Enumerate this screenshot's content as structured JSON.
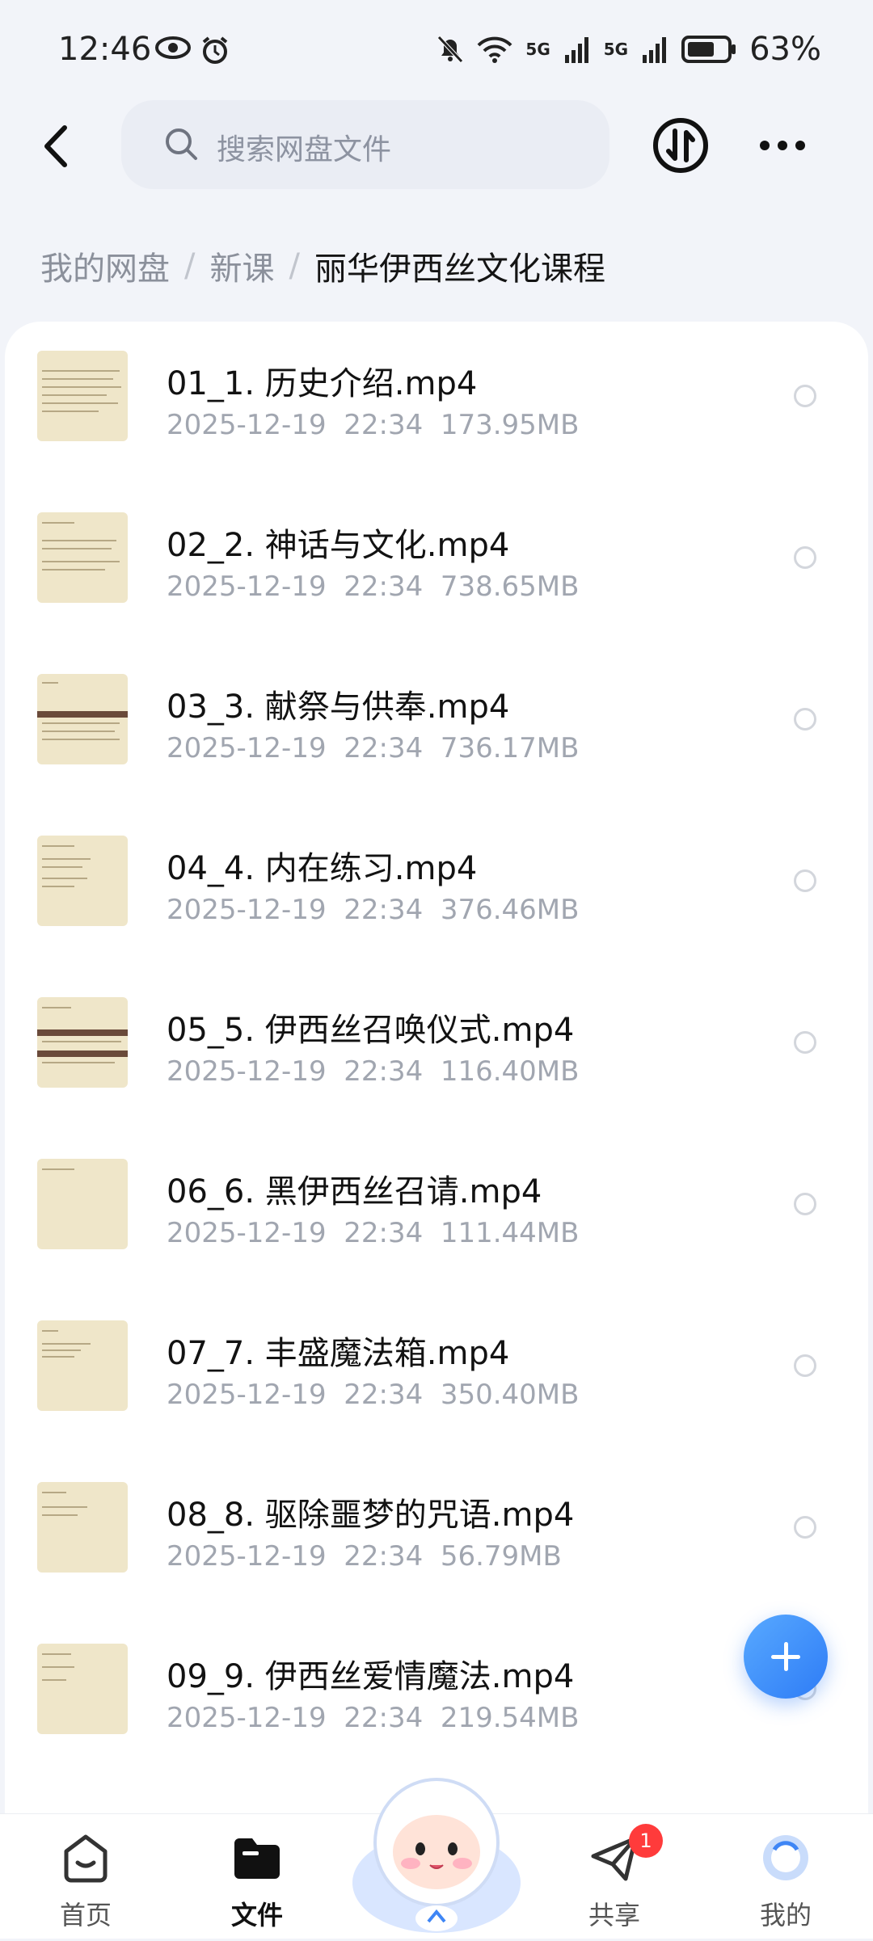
{
  "status_bar": {
    "time": "12:46",
    "signal_1": "5G",
    "signal_2": "5G",
    "battery_percent": "63%"
  },
  "search": {
    "placeholder": "搜索网盘文件"
  },
  "icons": {
    "back": "back-arrow-icon",
    "search": "search-icon",
    "transfer": "transfer-icon",
    "more": "more-dots-icon",
    "add": "plus-icon"
  },
  "breadcrumb": [
    {
      "label": "我的网盘"
    },
    {
      "label": "新课"
    },
    {
      "label": "丽华伊西丝文化课程"
    }
  ],
  "files": [
    {
      "name": "01_1. 历史介绍.mp4",
      "date": "2025-12-19",
      "time": "22:34",
      "size": "173.95MB"
    },
    {
      "name": "02_2. 神话与文化.mp4",
      "date": "2025-12-19",
      "time": "22:34",
      "size": "738.65MB"
    },
    {
      "name": "03_3. 献祭与供奉.mp4",
      "date": "2025-12-19",
      "time": "22:34",
      "size": "736.17MB"
    },
    {
      "name": "04_4. 内在练习.mp4",
      "date": "2025-12-19",
      "time": "22:34",
      "size": "376.46MB"
    },
    {
      "name": "05_5. 伊西丝召唤仪式.mp4",
      "date": "2025-12-19",
      "time": "22:34",
      "size": "116.40MB"
    },
    {
      "name": "06_6. 黑伊西丝召请.mp4",
      "date": "2025-12-19",
      "time": "22:34",
      "size": "111.44MB"
    },
    {
      "name": "07_7. 丰盛魔法箱.mp4",
      "date": "2025-12-19",
      "time": "22:34",
      "size": "350.40MB"
    },
    {
      "name": "08_8. 驱除噩梦的咒语.mp4",
      "date": "2025-12-19",
      "time": "22:34",
      "size": "56.79MB"
    },
    {
      "name": "09_9. 伊西丝爱情魔法.mp4",
      "date": "2025-12-19",
      "time": "22:34",
      "size": "219.54MB"
    }
  ],
  "tabbar": {
    "home": "首页",
    "files": "文件",
    "share": "共享",
    "share_badge": "1",
    "me": "我的"
  },
  "colors": {
    "accent": "#2e7cf6",
    "badge": "#ff3b3b",
    "thumb": "#efe6c9"
  }
}
